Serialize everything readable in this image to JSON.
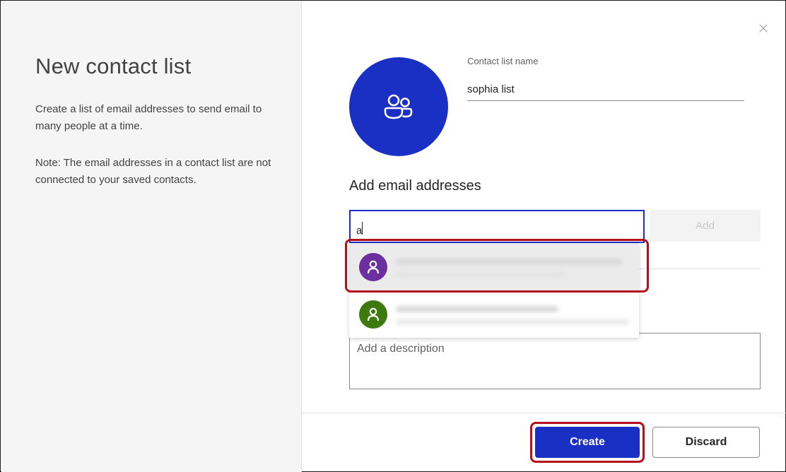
{
  "dialog": {
    "title": "New contact list",
    "description": "Create a list of email addresses to send email to many people at a time.",
    "note": "Note: The email addresses in a contact list are not connected to your saved contacts.",
    "close_icon": "close-icon"
  },
  "avatar": {
    "icon": "people-group-icon",
    "color": "#1a2fc4"
  },
  "name_field": {
    "label": "Contact list name",
    "value": "sophia list"
  },
  "emails": {
    "heading": "Add email addresses",
    "input_value": "a",
    "add_label": "Add",
    "suggestions": [
      {
        "avatar_color": "#6b2fa0",
        "icon": "person-icon",
        "selected": true
      },
      {
        "avatar_color": "#3d7a0e",
        "icon": "person-icon",
        "selected": false
      }
    ]
  },
  "description": {
    "placeholder": "Add a description"
  },
  "footer": {
    "create_label": "Create",
    "discard_label": "Discard"
  },
  "colors": {
    "accent": "#1a2fc4",
    "highlight": "#b3101b"
  }
}
